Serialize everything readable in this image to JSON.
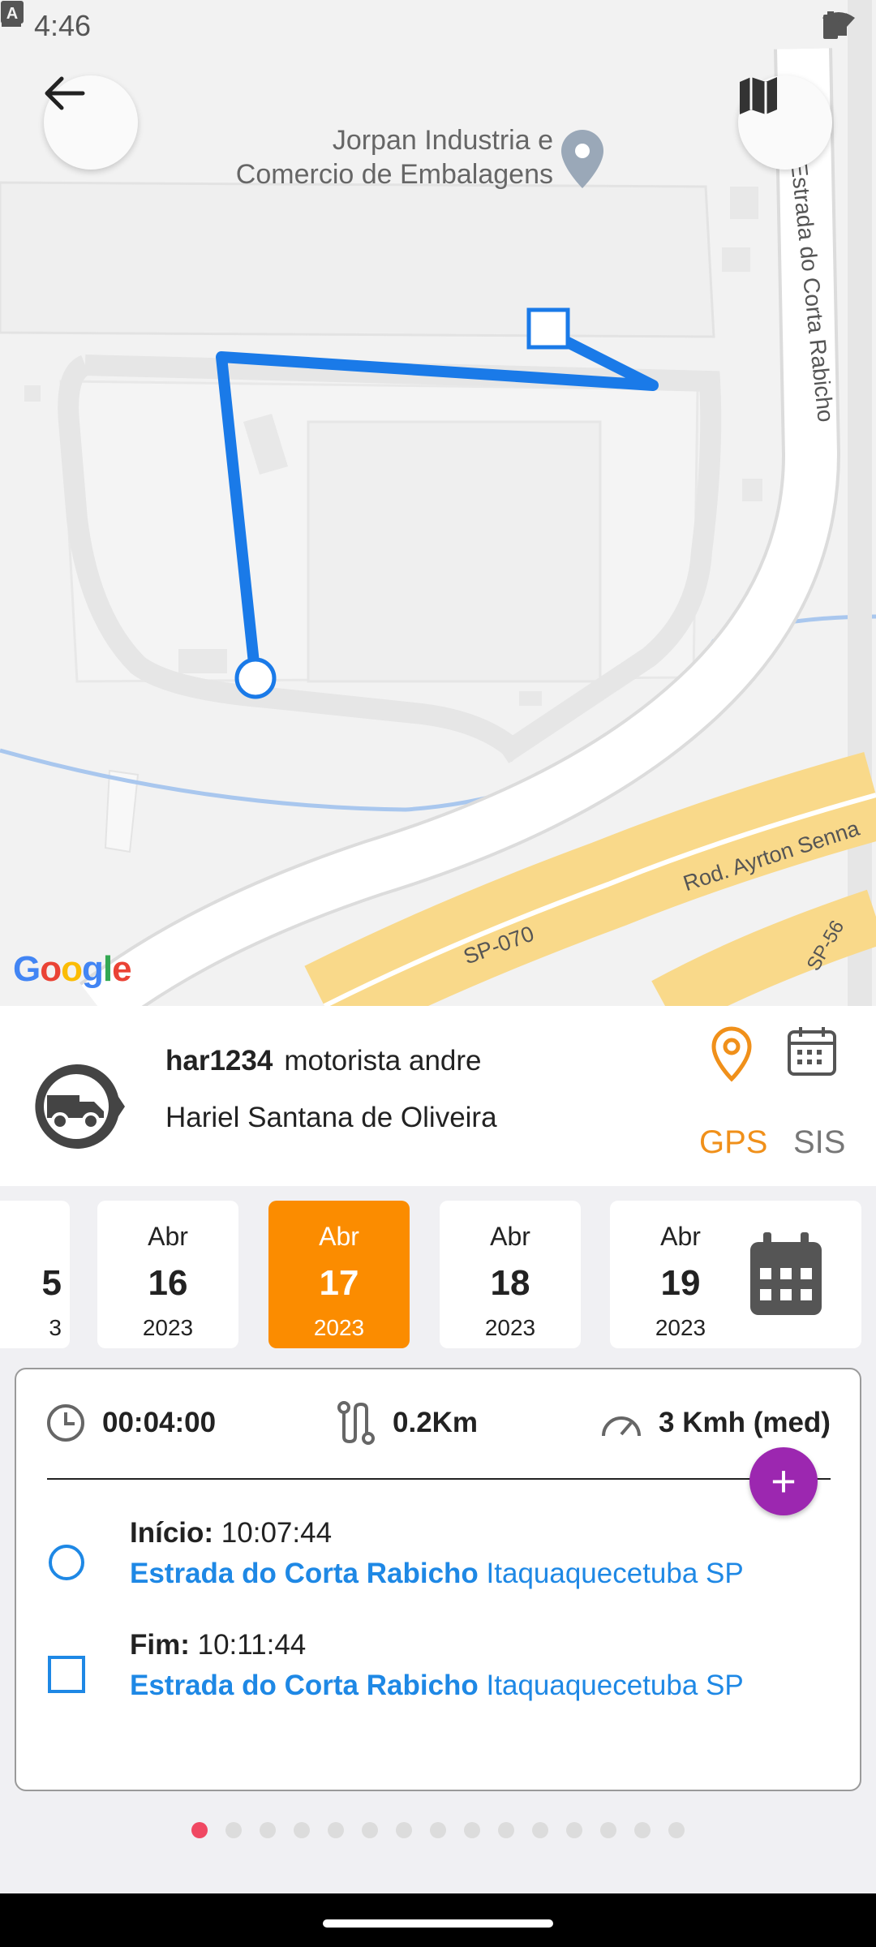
{
  "status_bar": {
    "time": "4:46",
    "left_icons": [
      "shield-play-icon",
      "sd-card-icon",
      "keyboard-a-icon"
    ],
    "right_icons": [
      "wifi-icon",
      "signal-icon",
      "battery-icon"
    ]
  },
  "map": {
    "back_icon": "arrow-left-icon",
    "layers_icon": "map-icon",
    "poi_name": "Jorpan Industria e Comercio de Embalagens",
    "roads": {
      "estrada": "Estrada do Corta Rabicho",
      "ayrton": "Rod. Ayrton Senna",
      "sp070": "SP-070",
      "sp56": "SP-56"
    },
    "attribution": "Google",
    "route_color": "#1a7ae8",
    "road_yellow": "#f9d98a"
  },
  "driver": {
    "plate": "har1234",
    "role": "motorista andre",
    "name": "Hariel Santana de Oliveira",
    "tabs": {
      "gps": "GPS",
      "sis": "SIS"
    },
    "active_tab": "GPS",
    "accent": "#f0901a"
  },
  "dates": [
    {
      "month": "Abr",
      "day": "16",
      "year": "2023",
      "selected": false
    },
    {
      "month": "Abr",
      "day": "17",
      "year": "2023",
      "selected": true
    },
    {
      "month": "Abr",
      "day": "18",
      "year": "2023",
      "selected": false
    },
    {
      "month": "Abr",
      "day": "19",
      "year": "2023",
      "selected": false
    }
  ],
  "partial_date": {
    "day": "5",
    "year": "3"
  },
  "trip": {
    "duration": "00:04:00",
    "distance": "0.2Km",
    "speed": "3 Kmh (med)",
    "fab_label": "+",
    "start": {
      "label": "Início:",
      "time": "10:07:44",
      "street": "Estrada do Corta Rabicho",
      "city": "Itaquaquecetuba SP"
    },
    "end": {
      "label": "Fim:",
      "time": "10:11:44",
      "street": "Estrada do Corta Rabicho",
      "city": "Itaquaquecetuba SP"
    }
  },
  "pager": {
    "count": 15,
    "active_index": 0,
    "active_color": "#f04862"
  }
}
